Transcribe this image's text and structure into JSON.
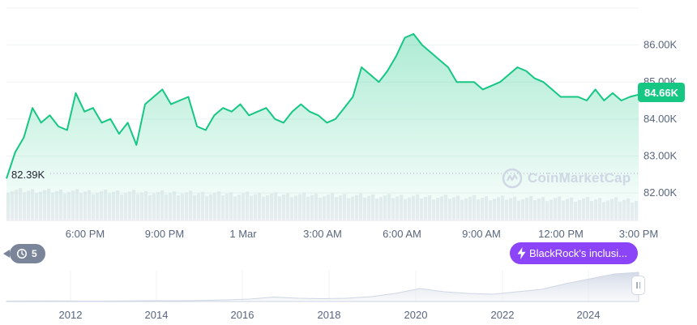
{
  "chart_data": [
    {
      "type": "area",
      "title": "",
      "xlabel": "",
      "ylabel": "",
      "ylim": [
        81.3,
        87.0
      ],
      "y_unit": "K",
      "x_ticks": [
        "6:00 PM",
        "9:00 PM",
        "1 Mar",
        "3:00 AM",
        "6:00 AM",
        "9:00 AM",
        "12:00 PM",
        "3:00 PM"
      ],
      "y_ticks": [
        "82.00K",
        "83.00K",
        "84.00K",
        "85.00K",
        "86.00K"
      ],
      "start_value_label": "82.39K",
      "last_price_label": "84.66K",
      "series": [
        {
          "values": [
            82.39,
            83.1,
            83.5,
            84.3,
            83.9,
            84.1,
            83.8,
            83.7,
            84.7,
            84.2,
            84.3,
            83.9,
            84.0,
            83.6,
            83.9,
            83.3,
            84.4,
            84.6,
            84.8,
            84.4,
            84.5,
            84.6,
            83.8,
            83.7,
            84.1,
            84.3,
            84.2,
            84.4,
            84.1,
            84.2,
            84.3,
            84.0,
            83.9,
            84.2,
            84.4,
            84.2,
            84.1,
            83.9,
            84.0,
            84.3,
            84.6,
            85.4,
            85.2,
            85.0,
            85.3,
            85.7,
            86.2,
            86.3,
            86.0,
            85.8,
            85.6,
            85.4,
            85.0,
            85.0,
            85.0,
            84.8,
            84.9,
            85.0,
            85.2,
            85.4,
            85.3,
            85.1,
            85.0,
            84.8,
            84.6,
            84.6,
            84.6,
            84.5,
            84.8,
            84.5,
            84.7,
            84.5,
            84.6,
            84.66
          ]
        }
      ],
      "grid": true,
      "y_axis_position": "right",
      "color": "#16c784"
    },
    {
      "type": "area",
      "title": "",
      "x_ticks": [
        "2012",
        "2014",
        "2016",
        "2018",
        "2020",
        "2022",
        "2024"
      ],
      "series": [
        {
          "values": [
            0.5,
            0.6,
            0.8,
            0.5,
            0.5,
            0.7,
            1.0,
            0.9,
            1.2,
            2.0,
            3.0,
            5.5,
            4.0,
            3.5,
            4.0,
            6.0,
            10.0,
            16.0,
            12.0,
            10.0,
            9.0,
            12.0,
            15.0,
            22.0,
            28.0,
            34.0,
            36.0
          ]
        }
      ],
      "color": "#cfd6e4"
    }
  ],
  "history_badge": {
    "count": "5",
    "icon": "history-icon"
  },
  "news_pill": {
    "label": "BlackRock's inclusi...",
    "icon": "lightning-icon",
    "color": "#8b44f7"
  },
  "watermark": {
    "text": "CoinMarketCap"
  },
  "colors": {
    "up": "#16c784",
    "axis_text": "#58667e",
    "grid": "#eff2f5",
    "navigator": "#cfd6e4"
  }
}
